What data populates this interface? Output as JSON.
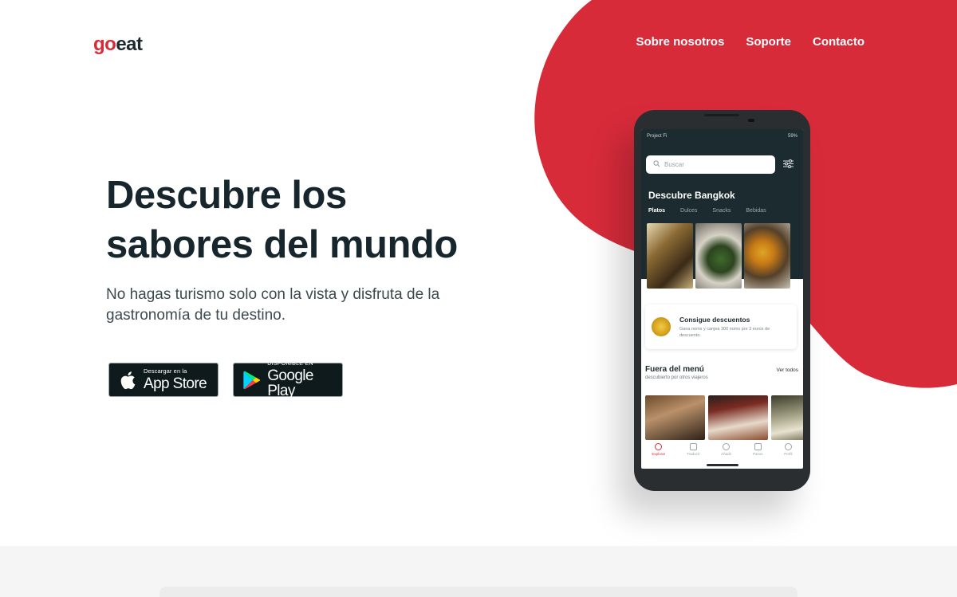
{
  "brand": {
    "go": "go",
    "eat": "eat",
    "accent": "#d72b3a"
  },
  "nav": {
    "items": [
      "Sobre nosotros",
      "Soporte",
      "Contacto"
    ]
  },
  "hero": {
    "title_line1": "Descubre los",
    "title_line2": "sabores del mundo",
    "subtitle": "No hagas turismo solo con la vista y disfruta de la gastronomía de tu destino."
  },
  "stores": {
    "apple": {
      "small": "Descargar en la",
      "big": "App Store",
      "icon": "apple-icon"
    },
    "google": {
      "small": "DISPONIBLE EN",
      "big": "Google Play",
      "icon": "google-play-icon"
    }
  },
  "app": {
    "status_left": "Project Fi",
    "status_right": "59%",
    "search_placeholder": "Buscar",
    "city_title": "Descubre Bangkok",
    "categories": [
      "Platos",
      "Dulces",
      "Snacks",
      "Bebidas"
    ],
    "promo": {
      "title": "Consigue descuentos",
      "desc": "Gana noms y canjea 300 noms por 3 euros de descuento."
    },
    "fuera": {
      "title": "Fuera del menú",
      "see_all": "Ver todos",
      "subtitle": "descubierto por otros viajeros"
    },
    "tabs": [
      "Explorar",
      "Traducir",
      "Añadir",
      "Pasos",
      "Perfil"
    ]
  },
  "colors": {
    "red": "#d72b3a",
    "dark": "#16262c",
    "phone": "#2b2e30",
    "app_header": "#1b2b30"
  }
}
